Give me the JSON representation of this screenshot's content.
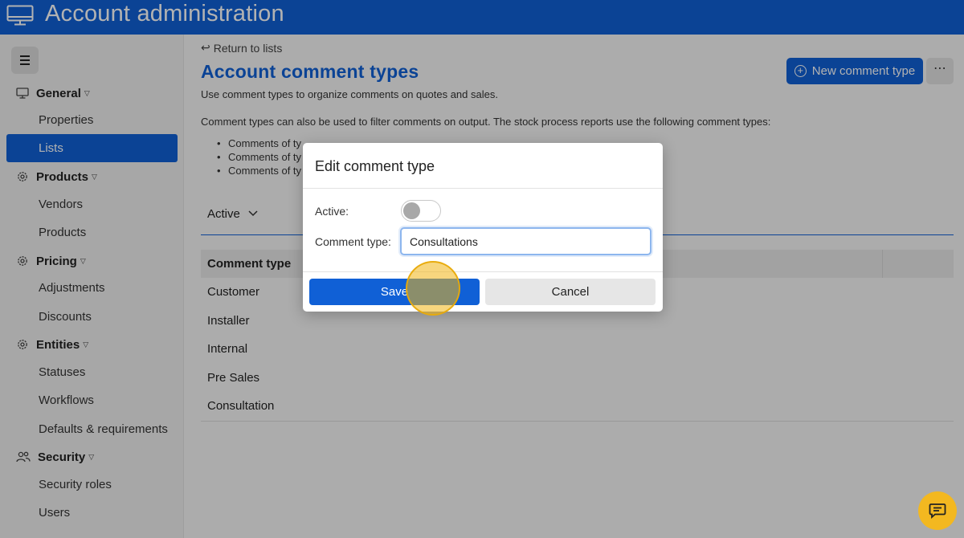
{
  "header": {
    "title": "Account administration",
    "icon": "monitor-icon"
  },
  "sidebar": {
    "menu_icon": "hamburger-icon",
    "sections": [
      {
        "label": "General",
        "icon": "monitor-icon",
        "items": [
          "Properties",
          "Lists"
        ]
      },
      {
        "label": "Products",
        "icon": "gear-icon",
        "items": [
          "Vendors",
          "Products"
        ]
      },
      {
        "label": "Pricing",
        "icon": "gear-icon",
        "items": [
          "Adjustments",
          "Discounts"
        ]
      },
      {
        "label": "Entities",
        "icon": "gear-icon",
        "items": [
          "Statuses",
          "Workflows",
          "Defaults & requirements"
        ]
      },
      {
        "label": "Security",
        "icon": "users-icon",
        "items": [
          "Security roles",
          "Users"
        ]
      }
    ],
    "selected_item": "Lists"
  },
  "main": {
    "return_link": "Return to lists",
    "title": "Account comment types",
    "description": "Use comment types to organize comments on quotes and sales.",
    "description2": "Comment types can also be used to filter comments on output. The stock process reports use the following comment types:",
    "bullets": [
      "Comments of ty",
      "Comments of ty",
      "Comments of ty"
    ],
    "new_button_label": "New comment type",
    "more_button_label": "⋯",
    "filter_label": "Active",
    "table": {
      "column_header": "Comment type",
      "rows": [
        "Customer",
        "Installer",
        "Internal",
        "Pre Sales",
        "Consultation"
      ]
    }
  },
  "modal": {
    "title": "Edit comment type",
    "active_label": "Active:",
    "active_value": false,
    "type_label": "Comment type:",
    "type_value": "Consultations",
    "save_label": "Save",
    "cancel_label": "Cancel"
  },
  "colors": {
    "primary": "#1060d6",
    "highlight": "#f3b820",
    "sidebar_bg": "#f0f0f0"
  }
}
